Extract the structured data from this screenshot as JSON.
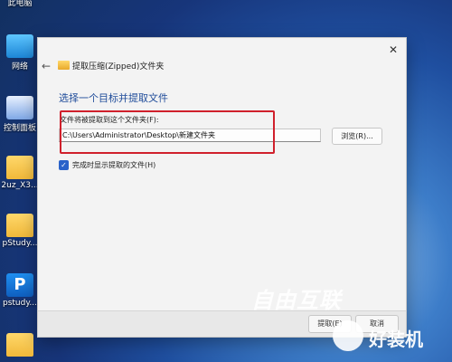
{
  "desktop": {
    "icons": [
      {
        "label": "此电脑",
        "icon": "computer-icon"
      },
      {
        "label": "网络",
        "icon": "network-icon"
      },
      {
        "label": "控制面板",
        "icon": "control-panel-icon"
      },
      {
        "label": "2uz_X3...",
        "icon": "folder-icon"
      },
      {
        "label": "pStudy...",
        "icon": "folder-icon"
      },
      {
        "label": "pstudy...",
        "icon": "app-p-icon"
      },
      {
        "label": "",
        "icon": "folder-icon"
      }
    ]
  },
  "dialog": {
    "title": "提取压缩(Zipped)文件夹",
    "heading": "选择一个目标并提取文件",
    "field_label": "文件将被提取到这个文件夹(F):",
    "path_value": "C:\\Users\\Administrator\\Desktop\\新建文件夹",
    "browse_label": "浏览(R)...",
    "checkbox_label": "完成时显示提取的文件(H)",
    "checkbox_checked": true,
    "extract_label": "提取(E)",
    "cancel_label": "取消"
  },
  "watermarks": {
    "primary": "自由互联",
    "secondary": "好装机"
  },
  "colors": {
    "accent": "#2a62c9",
    "heading": "#1f4c9a",
    "highlight": "#d0202c"
  }
}
